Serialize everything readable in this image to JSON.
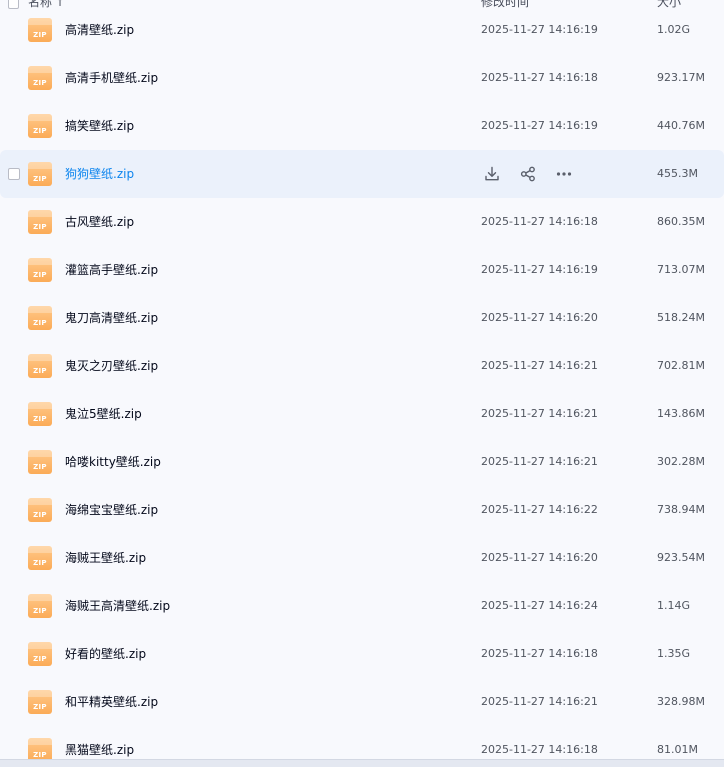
{
  "header": {
    "name_label": "名称",
    "sort_icon": "↑",
    "time_label": "修改时间",
    "size_label": "大小"
  },
  "icons": {
    "file_type": "zip-file-icon",
    "file_type_text": "ZIP",
    "download": "download-icon",
    "share": "share-icon",
    "more": "more-icon"
  },
  "colors": {
    "accent": "#0d85ee",
    "active_row": "#ebf1fb",
    "zip_icon": "#fbab57"
  },
  "files": [
    {
      "name": "高清壁纸.zip",
      "time": "2025-11-27 14:16:19",
      "size": "1.02G"
    },
    {
      "name": "高清手机壁纸.zip",
      "time": "2025-11-27 14:16:18",
      "size": "923.17M"
    },
    {
      "name": "搞笑壁纸.zip",
      "time": "2025-11-27 14:16:19",
      "size": "440.76M"
    },
    {
      "name": "狗狗壁纸.zip",
      "time": "",
      "size": "455.3M",
      "hovered": true
    },
    {
      "name": "古风壁纸.zip",
      "time": "2025-11-27 14:16:18",
      "size": "860.35M"
    },
    {
      "name": "灌篮高手壁纸.zip",
      "time": "2025-11-27 14:16:19",
      "size": "713.07M"
    },
    {
      "name": "鬼刀高清壁纸.zip",
      "time": "2025-11-27 14:16:20",
      "size": "518.24M"
    },
    {
      "name": "鬼灭之刃壁纸.zip",
      "time": "2025-11-27 14:16:21",
      "size": "702.81M"
    },
    {
      "name": "鬼泣5壁纸.zip",
      "time": "2025-11-27 14:16:21",
      "size": "143.86M"
    },
    {
      "name": "哈喽kitty壁纸.zip",
      "time": "2025-11-27 14:16:21",
      "size": "302.28M"
    },
    {
      "name": "海绵宝宝壁纸.zip",
      "time": "2025-11-27 14:16:22",
      "size": "738.94M"
    },
    {
      "name": "海贼王壁纸.zip",
      "time": "2025-11-27 14:16:20",
      "size": "923.54M"
    },
    {
      "name": "海贼王高清壁纸.zip",
      "time": "2025-11-27 14:16:24",
      "size": "1.14G"
    },
    {
      "name": "好看的壁纸.zip",
      "time": "2025-11-27 14:16:18",
      "size": "1.35G"
    },
    {
      "name": "和平精英壁纸.zip",
      "time": "2025-11-27 14:16:21",
      "size": "328.98M"
    },
    {
      "name": "黑猫壁纸.zip",
      "time": "2025-11-27 14:16:18",
      "size": "81.01M"
    }
  ]
}
